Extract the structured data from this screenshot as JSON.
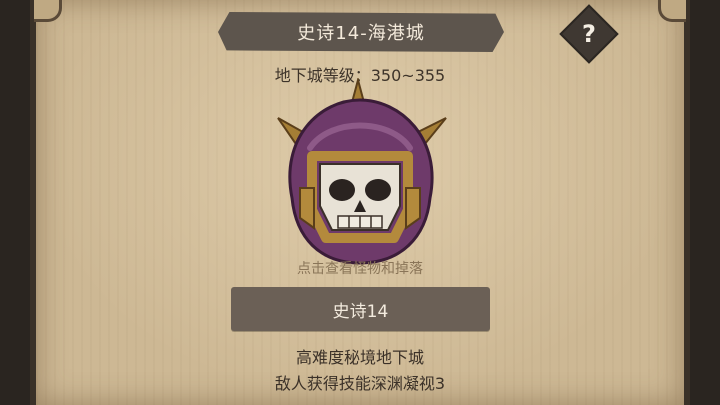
{
  "dungeon": {
    "title": "史诗14-海港城",
    "level_text": "地下城等级：350~355",
    "view_hint": "点击查看怪物和掉落",
    "action_label": "史诗14",
    "description_lines": [
      "高难度秘境地下城",
      "敌人获得技能深渊凝视3"
    ]
  },
  "help": {
    "label": "?"
  },
  "icons": {
    "monster": "skull-helmet-boss-icon",
    "help": "question-mark-icon"
  },
  "colors": {
    "parchment": "#cdb894",
    "banner": "#5d554d",
    "button": "#6b6056",
    "helmet_purple": "#6e3a6a",
    "helmet_gold": "#b38a3c"
  }
}
